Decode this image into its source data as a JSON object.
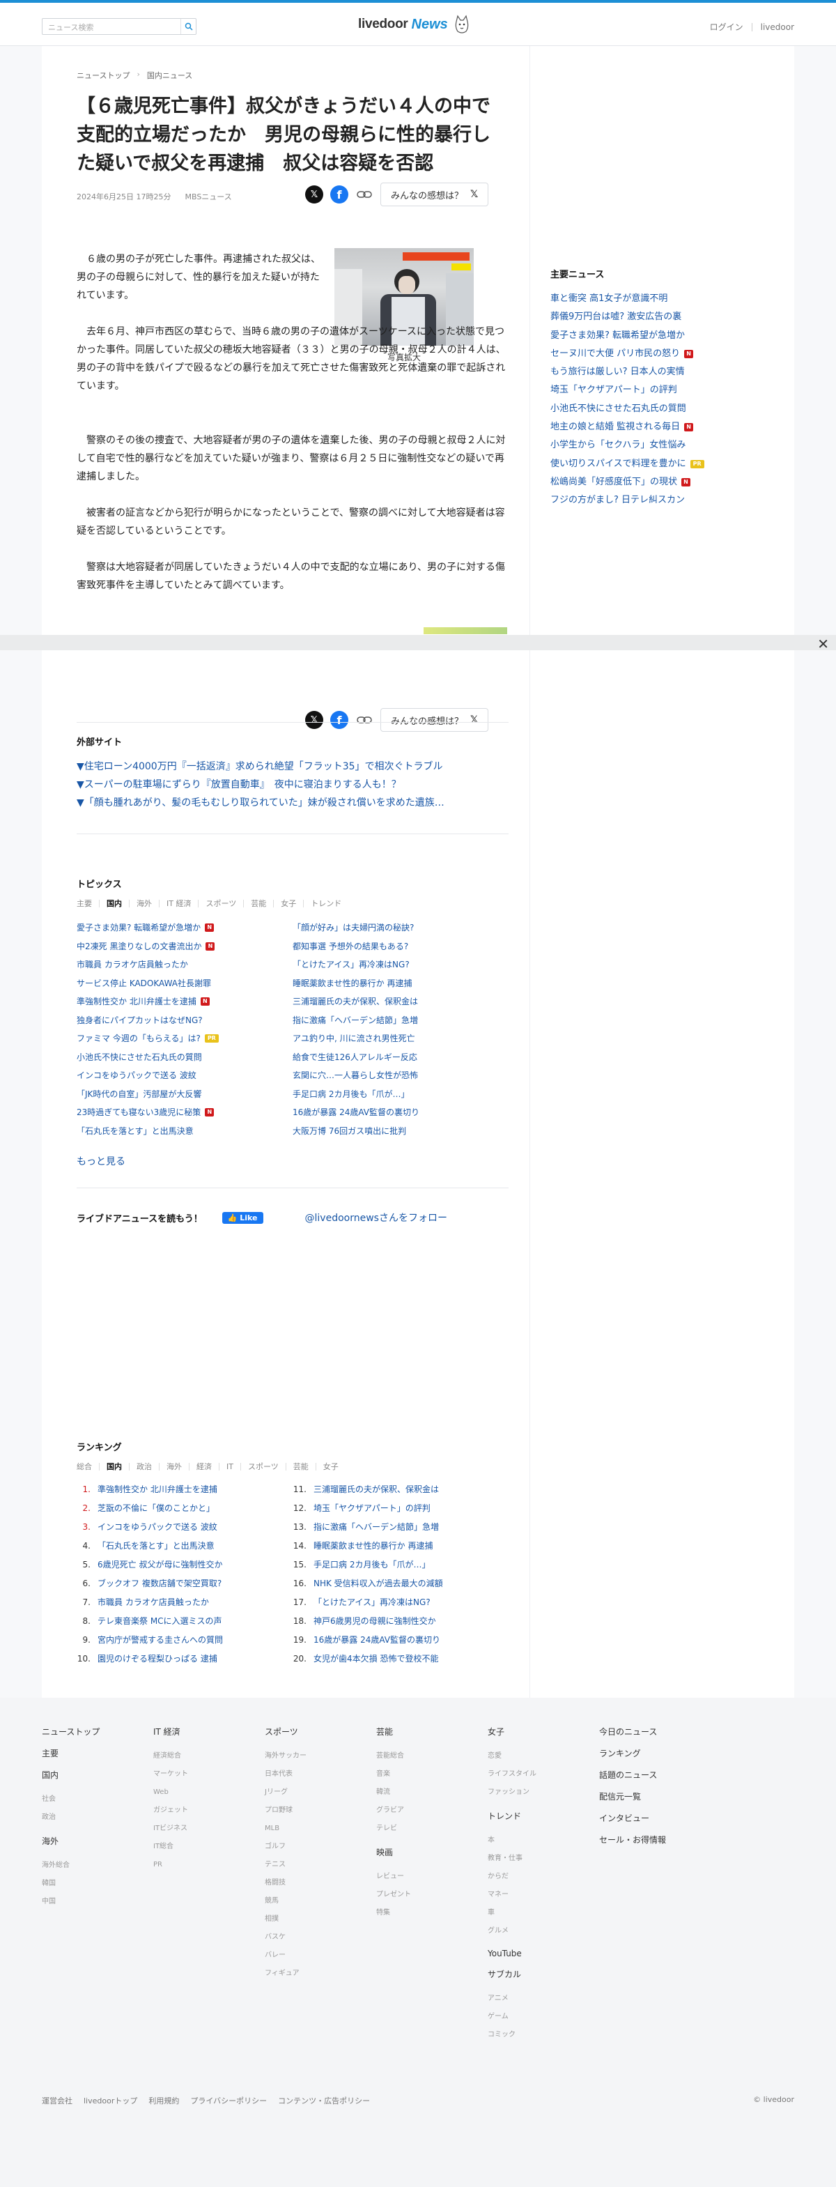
{
  "header": {
    "search_placeholder": "ニュース検索",
    "logo_main": "livedoor",
    "logo_sub": "News",
    "login": "ログイン",
    "livedoor": "livedoor"
  },
  "breadcrumb": [
    "ニューストップ",
    "国内ニュース"
  ],
  "article": {
    "title": "【６歳児死亡事件】叔父がきょうだい４人の中で支配的立場だったか　男児の母親らに性的暴行した疑いで叔父を再逮捕　叔父は容疑を否認",
    "date": "2024年6月25日 17時25分",
    "source": "MBSニュース",
    "feel_label": "みんなの感想は？",
    "photo_caption": "写真拡大",
    "paragraphs": [
      "６歳の男の子が死亡した事件。再逮捕された叔父は、男の子の母親らに対して、性的暴行を加えた疑いが持たれています。",
      "去年６月、神戸市西区の草むらで、当時６歳の男の子の遺体がスーツケースに入った状態で見つかった事件。同居していた叔父の穂坂大地容疑者（３３）と男の子の母親・叔母２人の計４人は、男の子の背中を鉄パイプで殴るなどの暴行を加えて死亡させた傷害致死と死体遺棄の罪で起訴されています。",
      "警察のその後の捜査で、大地容疑者が男の子の遺体を遺棄した後、男の子の母親と叔母２人に対して自宅で性的暴行などを加えていた疑いが強まり、警察は６月２５日に強制性交などの疑いで再逮捕しました。",
      "被害者の証言などから犯行が明らかになったということで、警察の調べに対して大地容疑者は容疑を否認しているということです。",
      "警察は大地容疑者が同居していたきょうだい４人の中で支配的な立場にあり、男の子に対する傷害致死事件を主導していたとみて調べています。"
    ]
  },
  "external": {
    "title": "外部サイト",
    "items": [
      "▼住宅ローン4000万円『一括返済』求められ絶望「フラット35」で相次ぐトラブル",
      "▼スーパーの駐車場にずらり『放置自動車』　夜中に寝泊まりする人も！？",
      "▼「顔も腫れあがり、髪の毛もむしり取られていた」妹が殺され償いを求めた遺族…"
    ]
  },
  "topics": {
    "title": "トピックス",
    "tabs": [
      "主要",
      "国内",
      "海外",
      "IT 経済",
      "スポーツ",
      "芸能",
      "女子",
      "トレンド"
    ],
    "active_tab": "国内",
    "left": [
      {
        "text": "愛子さま効果? 転職希望が急増か",
        "badge": "N"
      },
      {
        "text": "中2凍死 黒塗りなしの文書流出か",
        "badge": "N"
      },
      {
        "text": "市職員 カラオケ店員触ったか",
        "badge": ""
      },
      {
        "text": "サービス停止 KADOKAWA社長謝罪",
        "badge": ""
      },
      {
        "text": "準強制性交か 北川弁護士を逮捕",
        "badge": "N"
      },
      {
        "text": "独身者にパイプカットはなぜNG?",
        "badge": ""
      },
      {
        "text": "ファミマ 今週の「もらえる」は?",
        "badge": "PR"
      },
      {
        "text": "小池氏不快にさせた石丸氏の質問",
        "badge": ""
      },
      {
        "text": "インコをゆうパックで送る 波紋",
        "badge": ""
      },
      {
        "text": "「JK時代の自室」汚部屋が大反響",
        "badge": ""
      },
      {
        "text": "23時過ぎても寝ない3歳児に秘策",
        "badge": "N"
      },
      {
        "text": "「石丸氏を落とす」と出馬決意",
        "badge": ""
      }
    ],
    "right": [
      {
        "text": "「顔が好み」は夫婦円満の秘訣?",
        "badge": ""
      },
      {
        "text": "都知事選 予想外の結果もある?",
        "badge": ""
      },
      {
        "text": "「とけたアイス」再冷凍はNG?",
        "badge": ""
      },
      {
        "text": "睡眠薬飲ませ性的暴行か 再逮捕",
        "badge": ""
      },
      {
        "text": "三浦瑠麗氏の夫が保釈、保釈金は",
        "badge": ""
      },
      {
        "text": "指に激痛「ヘバーデン結節」急増",
        "badge": ""
      },
      {
        "text": "アユ釣り中, 川に流され男性死亡",
        "badge": ""
      },
      {
        "text": "給食で生徒126人アレルギー反応",
        "badge": ""
      },
      {
        "text": "玄関に穴…一人暮らし女性が恐怖",
        "badge": ""
      },
      {
        "text": "手足口病 2カ月後も「爪が…」",
        "badge": ""
      },
      {
        "text": "16歳が暴露 24歳AV監督の裏切り",
        "badge": ""
      },
      {
        "text": "大阪万博 76回ガス噴出に批判",
        "badge": ""
      }
    ],
    "more": "もっと見る"
  },
  "follow": {
    "label": "ライブドアニュースを読もう！",
    "like": "Like",
    "twitter": "@livedoornewsさんをフォロー"
  },
  "ranking": {
    "title": "ランキング",
    "tabs": [
      "総合",
      "国内",
      "政治",
      "海外",
      "経済",
      "IT",
      "スポーツ",
      "芸能",
      "女子"
    ],
    "active_tab": "国内",
    "left": [
      {
        "n": "1.",
        "text": "準強制性交か 北川弁護士を逮捕"
      },
      {
        "n": "2.",
        "text": "芝翫の不倫に「僕のことかと」"
      },
      {
        "n": "3.",
        "text": "インコをゆうパックで送る 波紋"
      },
      {
        "n": "4.",
        "text": "「石丸氏を落とす」と出馬決意"
      },
      {
        "n": "5.",
        "text": "6歳児死亡 叔父が母に強制性交か"
      },
      {
        "n": "6.",
        "text": "ブックオフ 複数店舗で架空買取?"
      },
      {
        "n": "7.",
        "text": "市職員 カラオケ店員触ったか"
      },
      {
        "n": "8.",
        "text": "テレ東音楽祭 MCに入選ミスの声"
      },
      {
        "n": "9.",
        "text": "宮内庁が警戒する圭さんへの質問"
      },
      {
        "n": "10.",
        "text": "園児のけぞる程梨ひっぱる 逮捕"
      }
    ],
    "right": [
      {
        "n": "11.",
        "text": "三浦瑠麗氏の夫が保釈、保釈金は"
      },
      {
        "n": "12.",
        "text": "埼玉「ヤクザアパート」の評判"
      },
      {
        "n": "13.",
        "text": "指に激痛「ヘバーデン結節」急増"
      },
      {
        "n": "14.",
        "text": "睡眠薬飲ませ性的暴行か 再逮捕"
      },
      {
        "n": "15.",
        "text": "手足口病 2カ月後も「爪が…」"
      },
      {
        "n": "16.",
        "text": "NHK 受信料収入が過去最大の減額"
      },
      {
        "n": "17.",
        "text": "「とけたアイス」再冷凍はNG?"
      },
      {
        "n": "18.",
        "text": "神戸6歳男児の母親に強制性交か"
      },
      {
        "n": "19.",
        "text": "16歳が暴露 24歳AV監督の裏切り"
      },
      {
        "n": "20.",
        "text": "女児が歯4本欠損 恐怖で登校不能"
      }
    ]
  },
  "main_news": {
    "title": "主要ニュース",
    "items": [
      {
        "text": "車と衝突 高1女子が意識不明",
        "badge": ""
      },
      {
        "text": "葬儀9万円台は嘘? 激安広告の裏",
        "badge": ""
      },
      {
        "text": "愛子さま効果? 転職希望が急増か",
        "badge": ""
      },
      {
        "text": "セーヌ川で大便 パリ市民の怒り",
        "badge": "N"
      },
      {
        "text": "もう旅行は厳しい? 日本人の実情",
        "badge": ""
      },
      {
        "text": "埼玉「ヤクザアパート」の評判",
        "badge": ""
      },
      {
        "text": "小池氏不快にさせた石丸氏の質問",
        "badge": ""
      },
      {
        "text": "地主の娘と結婚 監視される毎日",
        "badge": "N"
      },
      {
        "text": "小学生から「セクハラ」女性悩み",
        "badge": ""
      },
      {
        "text": "使い切りスパイスで料理を豊かに",
        "badge": "PR"
      },
      {
        "text": "松嶋尚美「好感度低下」の現状",
        "badge": "N"
      },
      {
        "text": "フジの方がまし? 日テレ糾スカン",
        "badge": ""
      }
    ]
  },
  "footer": {
    "cols": [
      {
        "groups": [
          {
            "h": "ニューストップ",
            "items": []
          },
          {
            "h": "主要",
            "items": []
          },
          {
            "h": "国内",
            "items": [
              "社会",
              "政治"
            ]
          },
          {
            "h": "海外",
            "items": [
              "海外総合",
              "韓国",
              "中国"
            ]
          }
        ]
      },
      {
        "groups": [
          {
            "h": "IT 経済",
            "items": [
              "経済総合",
              "マーケット",
              "Web",
              "ガジェット",
              "ITビジネス",
              "IT総合",
              "PR"
            ]
          }
        ]
      },
      {
        "groups": [
          {
            "h": "スポーツ",
            "items": [
              "海外サッカー",
              "日本代表",
              "Jリーグ",
              "プロ野球",
              "MLB",
              "ゴルフ",
              "テニス",
              "格闘技",
              "競馬",
              "相撲",
              "バスケ",
              "バレー",
              "フィギュア"
            ]
          }
        ]
      },
      {
        "groups": [
          {
            "h": "芸能",
            "items": [
              "芸能総合",
              "音楽",
              "韓流",
              "グラビア",
              "テレビ"
            ]
          },
          {
            "h": "映画",
            "items": [
              "レビュー",
              "プレゼント",
              "特集"
            ]
          }
        ]
      },
      {
        "groups": [
          {
            "h": "女子",
            "items": [
              "恋愛",
              "ライフスタイル",
              "ファッション"
            ]
          },
          {
            "h": "トレンド",
            "items": [
              "本",
              "教育・仕事",
              "からだ",
              "マネー",
              "車",
              "グルメ"
            ]
          },
          {
            "h": "YouTube",
            "items": []
          },
          {
            "h": "サブカル",
            "items": [
              "アニメ",
              "ゲーム",
              "コミック"
            ]
          }
        ]
      },
      {
        "groups": [
          {
            "h": "今日のニュース",
            "items": []
          },
          {
            "h": "ランキング",
            "items": []
          },
          {
            "h": "話題のニュース",
            "items": []
          },
          {
            "h": "配信元一覧",
            "items": []
          },
          {
            "h": "インタビュー",
            "items": []
          },
          {
            "h": "セール・お得情報",
            "items": []
          }
        ]
      }
    ],
    "bottom_links": [
      "運営会社",
      "livedoorトップ",
      "利用規約",
      "プライバシーポリシー",
      "コンテンツ・広告ポリシー"
    ],
    "copyright": "© livedoor"
  },
  "colors": {
    "accent": "#1c8fd5",
    "link": "#1856a6",
    "new_badge": "#d0191b",
    "pr_badge": "#e9c21b"
  }
}
